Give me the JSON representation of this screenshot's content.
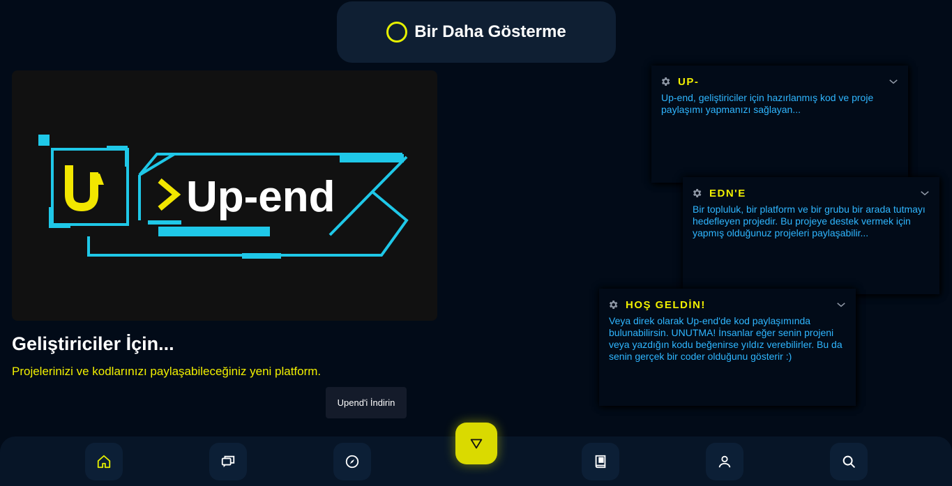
{
  "top_toggle": {
    "label": "Bir Daha Gösterme",
    "icon": "circle-radio-icon"
  },
  "hero": {
    "logo_text": "Up-end",
    "logo_prompt": ">",
    "headline": "Geliştiriciler İçin...",
    "subline": "Projelerinizi ve kodlarınızı paylaşabileceğiniz yeni platform.",
    "download_label": "Upend'i İndirin"
  },
  "cards": [
    {
      "title": "UP-",
      "body": "Up-end, geliştiriciler için hazırlanmış kod ve proje paylaşımı yapmanızı sağlayan..."
    },
    {
      "title": "EDN'E",
      "body": "Bir topluluk, bir platform ve bir grubu bir arada tutmayı hedefleyen projedir. Bu projeye destek vermek için yapmış olduğunuz projeleri paylaşabilir..."
    },
    {
      "title": "HOŞ GELDİN!",
      "body": "Veya direk olarak Up-end'de kod paylaşımında bulunabilirsin. UNUTMA! İnsanlar eğer senin projeni veya yazdığın kodu beğenirse yıldız verebilirler. Bu da senin gerçek bir coder olduğunu gösterir :)"
    }
  ],
  "nav": {
    "items": [
      {
        "icon": "home-icon",
        "active": true
      },
      {
        "icon": "chat-icon",
        "active": false
      },
      {
        "icon": "compass-icon",
        "active": false
      },
      {
        "icon": "book-icon",
        "active": false
      },
      {
        "icon": "user-icon",
        "active": false
      },
      {
        "icon": "search-icon",
        "active": false
      }
    ],
    "fab_icon": "triangle-down-icon"
  },
  "colors": {
    "background": "#020b18",
    "accent_yellow": "#f2f000",
    "text_blue": "#2fb6ff",
    "logo_cyan": "#1fc8e8"
  }
}
